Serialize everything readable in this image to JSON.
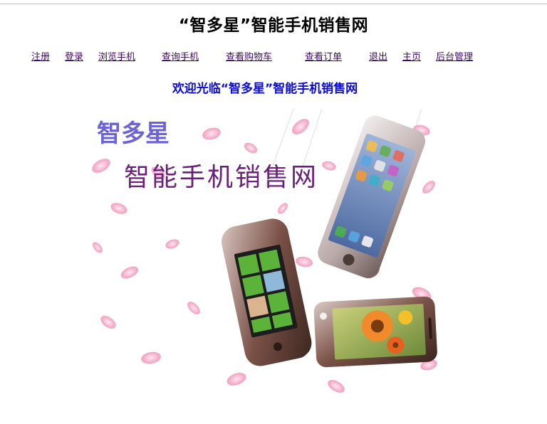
{
  "page": {
    "site_title": "“智多星”智能手机销售网",
    "welcome": "欢迎光临“智多星”智能手机销售网"
  },
  "nav": {
    "items": [
      {
        "label": "注册"
      },
      {
        "label": "登录"
      },
      {
        "label": "浏览手机"
      },
      {
        "label": "查询手机"
      },
      {
        "label": "查看购物车"
      },
      {
        "label": "查看订单"
      },
      {
        "label": "退出"
      },
      {
        "label": "主页"
      },
      {
        "label": "后台管理"
      }
    ]
  },
  "banner": {
    "brand": "智多星",
    "slogan": "智能手机销售网"
  },
  "colors": {
    "link": "#3d0a66",
    "welcome": "#0b0bd6",
    "brand": "#6b63d6",
    "slogan": "#6b1f7a",
    "petal": "#f3a9c6"
  }
}
